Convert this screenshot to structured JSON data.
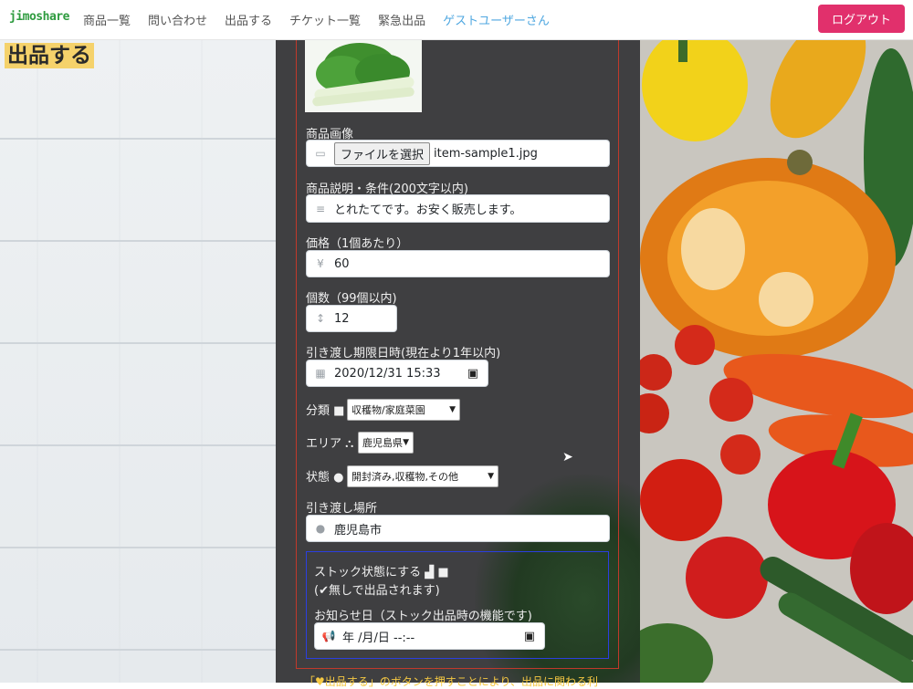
{
  "nav": {
    "brand": "jimoshare",
    "links": [
      "商品一覧",
      "問い合わせ",
      "出品する",
      "チケット一覧",
      "緊急出品"
    ],
    "user": "ゲストユーザーさん",
    "logout": "ログアウト"
  },
  "page_title": "出品する",
  "form": {
    "image_label": "商品画像",
    "file_button": "ファイルを選択",
    "file_name": "item-sample1.jpg",
    "desc_label": "商品説明・条件(200文字以内)",
    "desc_value": "とれたてです。お安く販売します。",
    "price_label": "価格（1個あたり）",
    "price_value": "60",
    "qty_label": "個数（99個以内)",
    "qty_value": "12",
    "deadline_label": "引き渡し期限日時(現在より1年以内)",
    "deadline_value": "2020/12/31 15:33",
    "category_label": "分類",
    "category_value": "収穫物/家庭菜園",
    "area_label": "エリア",
    "area_value": "鹿児島県",
    "condition_label": "状態",
    "condition_value": "開封済み,収穫物,その他",
    "place_label": "引き渡し場所",
    "place_value": "鹿児島市",
    "stock_label": "ストック状態にする",
    "stock_note": "(✔無しで出品されます)",
    "notify_label": "お知らせ日（ストック出品時の機能です)",
    "notify_value": "年 /月/日 --:--"
  },
  "footer_note": "「♥出品する」のボタンを押すことにより、出品に関わる利"
}
